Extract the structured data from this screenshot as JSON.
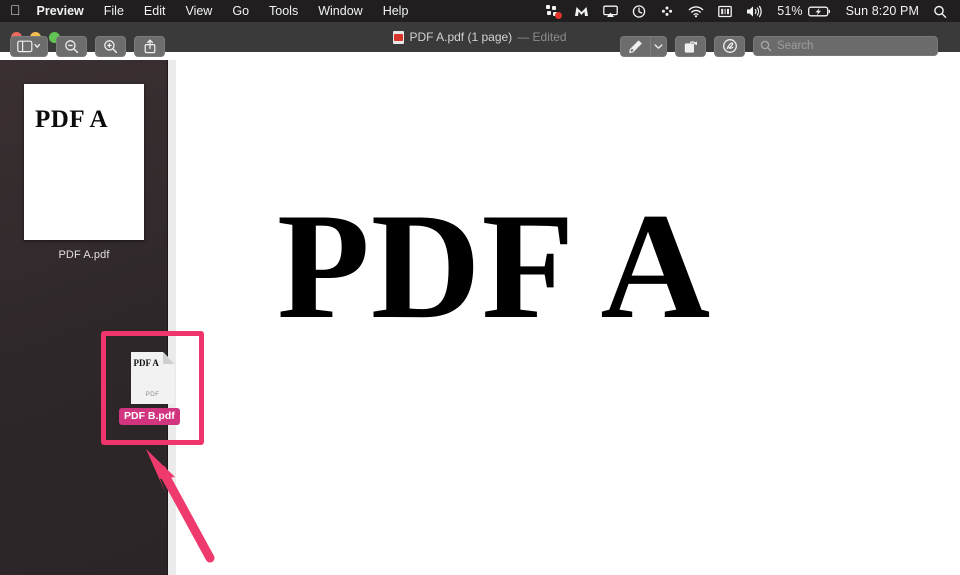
{
  "menubar": {
    "apple_glyph": "",
    "items": [
      {
        "label": "Preview",
        "bold": true
      },
      {
        "label": "File"
      },
      {
        "label": "Edit"
      },
      {
        "label": "View"
      },
      {
        "label": "Go"
      },
      {
        "label": "Tools"
      },
      {
        "label": "Window"
      },
      {
        "label": "Help"
      }
    ],
    "status": {
      "battery_percent": "51%",
      "clock": "Sun 8:20 PM",
      "icons": [
        "app-badge-icon",
        "malwarebytes-icon",
        "airplay-icon",
        "time-machine-icon",
        "dropbox-icon",
        "wifi-icon",
        "display-icon",
        "volume-icon",
        "battery-charging-icon",
        "spotlight-search-icon"
      ]
    }
  },
  "window": {
    "title": "PDF A.pdf (1 page)",
    "edited_suffix": "— Edited",
    "traffic_lights": [
      "close",
      "minimize",
      "zoom"
    ]
  },
  "toolbar": {
    "sidebar_toggle": "sidebar-toggle",
    "zoom_out": "zoom-out",
    "zoom_in": "zoom-in",
    "share": "share",
    "markup": "markup-pen",
    "rotate": "rotate",
    "annotate": "annotate",
    "search": {
      "placeholder": "Search",
      "value": ""
    }
  },
  "sidebar": {
    "thumbnails": [
      {
        "page_text": "PDF A",
        "label": "PDF A.pdf"
      }
    ]
  },
  "drag": {
    "file_title": "PDF A",
    "file_kind": "PDF",
    "name_label": "PDF B.pdf",
    "highlight_color": "#f0356c",
    "label_color": "#d2357f"
  },
  "document": {
    "page_text": "PDF A"
  },
  "annotation": {
    "arrow_color": "#ef3a6e",
    "arrow_points_to": "drag-highlight-box"
  }
}
